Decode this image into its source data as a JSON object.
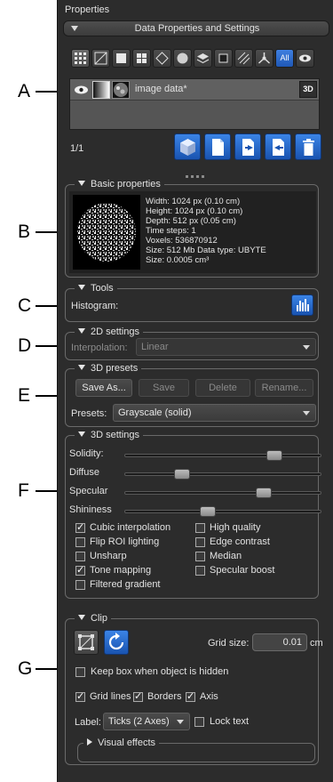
{
  "markers": [
    "A",
    "B",
    "C",
    "D",
    "E",
    "F",
    "G"
  ],
  "panel": {
    "title": "Properties",
    "section_header": "Data Properties and Settings",
    "toolbar": {
      "icons": [
        "grid-icon",
        "slice-icon",
        "box-icon",
        "tiles-icon",
        "diamond-icon",
        "sphere-icon",
        "layers-icon",
        "crop-icon",
        "hatch-icon",
        "network-icon"
      ],
      "all_label": "All"
    },
    "dataset": {
      "name": "image data*",
      "badge": "3D",
      "pager": "1/1"
    },
    "basic": {
      "title": "Basic properties",
      "lines": [
        "Width: 1024 px (0.10 cm)",
        "Height: 1024 px (0.10 cm)",
        "Depth: 512 px (0.05 cm)",
        "Time steps: 1",
        "Voxels: 536870912",
        "Size: 512 Mb  Data type: UBYTE",
        "Size: 0.0005 cm³"
      ]
    },
    "tools": {
      "title": "Tools",
      "histogram_label": "Histogram:"
    },
    "settings2d": {
      "title": "2D settings",
      "interp_label": "Interpolation:",
      "interp_value": "Linear"
    },
    "presets3d": {
      "title": "3D presets",
      "buttons": [
        "Save As...",
        "Save",
        "Delete",
        "Rename..."
      ],
      "presets_label": "Presets:",
      "presets_value": "Grayscale (solid)"
    },
    "settings3d": {
      "title": "3D settings",
      "sliders": [
        {
          "label": "Solidity:",
          "value": 0.78
        },
        {
          "label": "Diffuse",
          "value": 0.27
        },
        {
          "label": "Specular",
          "value": 0.72
        },
        {
          "label": "Shininess",
          "value": 0.41
        }
      ],
      "checks_left": [
        {
          "label": "Cubic interpolation",
          "checked": true
        },
        {
          "label": "Flip ROI lighting",
          "checked": false
        },
        {
          "label": "Unsharp",
          "checked": false
        },
        {
          "label": "Tone mapping",
          "checked": true
        },
        {
          "label": "Filtered gradient",
          "checked": false
        }
      ],
      "checks_right": [
        {
          "label": "High quality",
          "checked": false
        },
        {
          "label": "Edge contrast",
          "checked": false
        },
        {
          "label": "Median",
          "checked": false
        },
        {
          "label": "Specular boost",
          "checked": false
        }
      ]
    },
    "clip": {
      "title": "Clip",
      "grid_size_label": "Grid size:",
      "grid_size_value": "0.01",
      "grid_unit": "cm",
      "keep_box_label": "Keep box when object is hidden",
      "keep_box_checked": false,
      "grid_lines_label": "Grid lines",
      "grid_lines_checked": true,
      "borders_label": "Borders",
      "borders_checked": true,
      "axis_label": "Axis",
      "axis_checked": true,
      "label_label": "Label:",
      "label_value": "Ticks (2 Axes)",
      "lock_text_label": "Lock text",
      "lock_text_checked": false,
      "visual_effects_label": "Visual effects"
    }
  }
}
